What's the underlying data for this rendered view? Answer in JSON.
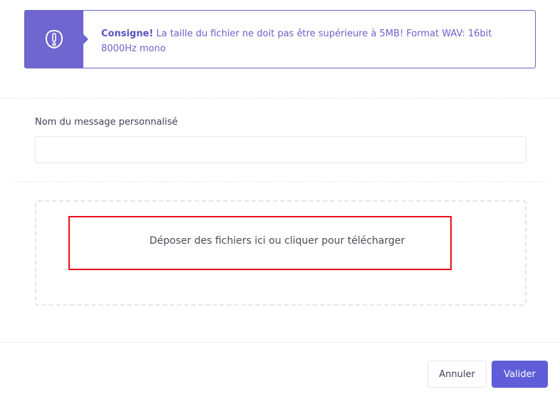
{
  "alert": {
    "icon": "exclamation-icon",
    "title": "Consigne!",
    "message": " La taille du fichier ne doit pas être supérieure à 5MB! Format WAV: 16bit 8000Hz mono",
    "accent_color": "#6f66cf"
  },
  "form": {
    "name_label": "Nom du message personnalisé",
    "name_value": "",
    "dropzone_message": "Déposer des fichiers ici ou cliquer pour télécharger",
    "highlight_color": "#e8101a"
  },
  "footer": {
    "cancel_label": "Annuler",
    "submit_label": "Valider",
    "submit_color": "#5f5ed8"
  }
}
